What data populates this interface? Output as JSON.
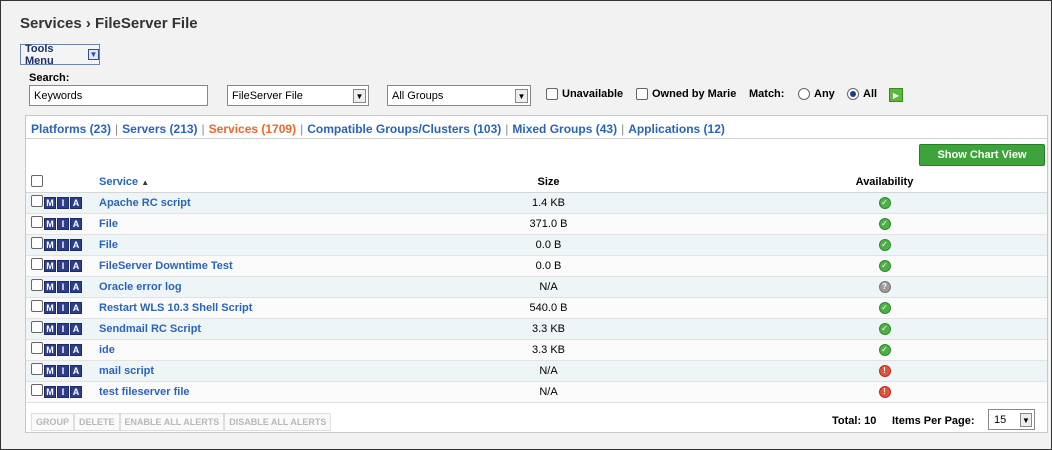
{
  "page_title": "Services › FileServer File",
  "tools_menu": {
    "label": "Tools Menu",
    "icon": "chevron-down-icon"
  },
  "search": {
    "label": "Search:",
    "value": "Keywords"
  },
  "type_select": {
    "value": "FileServer File"
  },
  "group_select": {
    "value": "All Groups"
  },
  "filters": {
    "unavailable": {
      "label": "Unavailable",
      "checked": false
    },
    "owned_by": {
      "label": "Owned by Marie",
      "checked": false
    },
    "match_label": "Match:",
    "match_any": {
      "label": "Any",
      "selected": false
    },
    "match_all": {
      "label": "All",
      "selected": true
    }
  },
  "tabs": [
    {
      "label": "Platforms (23)",
      "active": false
    },
    {
      "label": "Servers (213)",
      "active": false
    },
    {
      "label": "Services (1709)",
      "active": true
    },
    {
      "label": "Compatible Groups/Clusters (103)",
      "active": false
    },
    {
      "label": "Mixed Groups (43)",
      "active": false
    },
    {
      "label": "Applications (12)",
      "active": false
    }
  ],
  "chart_button": "Show Chart View",
  "table": {
    "headers": {
      "service": "Service",
      "sort_indicator": "▲",
      "size": "Size",
      "availability": "Availability"
    },
    "mia_letters": [
      "M",
      "I",
      "A"
    ],
    "rows": [
      {
        "name": "Apache RC script",
        "size": "1.4 KB",
        "availability": "ok"
      },
      {
        "name": "File",
        "size": "371.0 B",
        "availability": "ok"
      },
      {
        "name": "File",
        "size": "0.0 B",
        "availability": "ok"
      },
      {
        "name": "FileServer Downtime Test",
        "size": "0.0 B",
        "availability": "ok"
      },
      {
        "name": "Oracle error log",
        "size": "N/A",
        "availability": "unknown"
      },
      {
        "name": "Restart WLS 10.3 Shell Script",
        "size": "540.0 B",
        "availability": "ok"
      },
      {
        "name": "Sendmail RC Script",
        "size": "3.3 KB",
        "availability": "ok"
      },
      {
        "name": "ide",
        "size": "3.3 KB",
        "availability": "ok"
      },
      {
        "name": "mail script",
        "size": "N/A",
        "availability": "down"
      },
      {
        "name": "test fileserver file",
        "size": "N/A",
        "availability": "down"
      }
    ]
  },
  "footer": {
    "actions": [
      "GROUP",
      "DELETE",
      "ENABLE ALL ALERTS",
      "DISABLE ALL ALERTS"
    ],
    "total": "Total: 10",
    "items_per_page_label": "Items Per Page:",
    "items_per_page": "15"
  },
  "colors": {
    "link": "#2a64b8",
    "active_tab": "#e8692a",
    "chart_button": "#3da33a",
    "avail_ok": "#4fb04a",
    "avail_down": "#e0523b"
  }
}
